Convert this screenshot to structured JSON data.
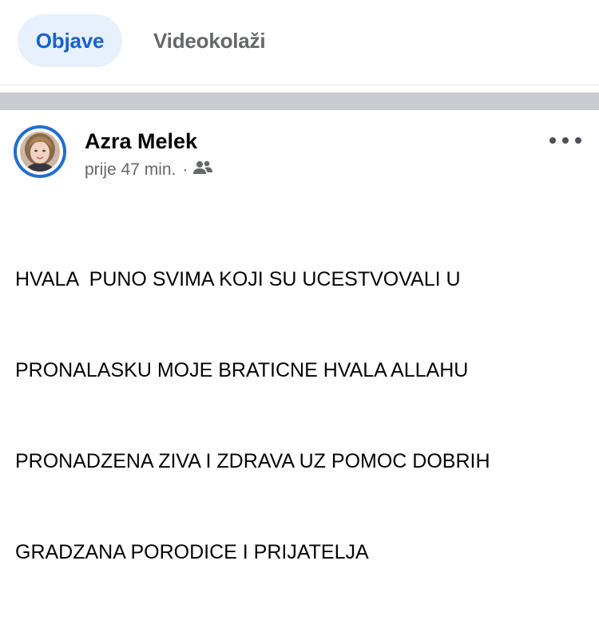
{
  "tabs": {
    "active_label": "Objave",
    "inactive_label": "Videokolaži"
  },
  "post": {
    "author": "Azra Melek",
    "time": "prije 47 min.",
    "separator": "·",
    "audience_icon": "friends-icon",
    "more_icon": "more-options-icon",
    "text_lines": [
      "HVALA  PUNO SVIMA KOJI SU UCESTVOVALI U",
      "PRONALASKU MOJE BRATICNE HVALA ALLAHU",
      "PRONADZENA ZIVA I ZDRAVA UZ POMOC DOBRIH",
      "GRADZANA PORODICE I PRIJATELJA"
    ]
  },
  "colors": {
    "accent": "#1763cf",
    "active_tab_bg": "#e7f0fb",
    "ring": "#1f6fd0",
    "secondary_text": "#65676b",
    "gap": "#c9ccd1"
  }
}
